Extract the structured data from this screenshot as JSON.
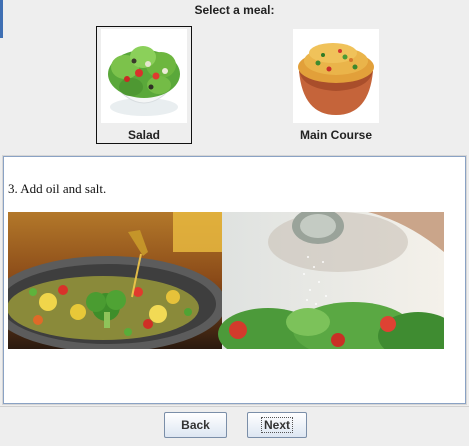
{
  "header": {
    "title": "Select a meal:"
  },
  "meals": [
    {
      "label": "Salad",
      "selected": true
    },
    {
      "label": "Main Course",
      "selected": false
    }
  ],
  "content": {
    "step_text": "3. Add oil and salt."
  },
  "footer": {
    "back_label": "Back",
    "next_label": "Next"
  }
}
